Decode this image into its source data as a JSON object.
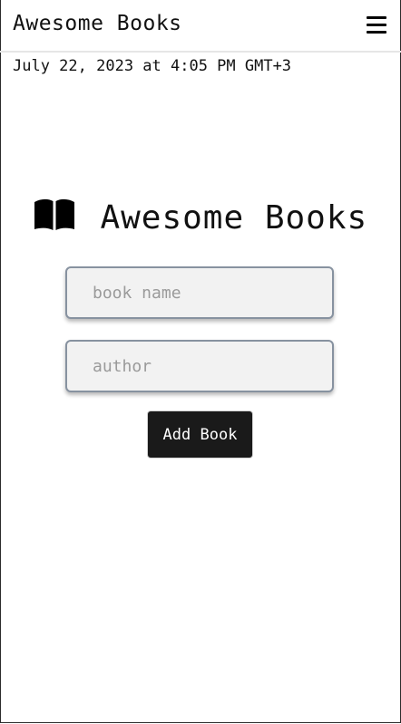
{
  "navbar": {
    "brand": "Awesome Books",
    "menu_icon": "hamburger-menu-icon"
  },
  "datetime": "July 22, 2023 at 4:05 PM GMT+3",
  "form": {
    "heading_icon": "open-book-icon",
    "heading": "Awesome Books",
    "title_input": {
      "value": "",
      "placeholder": "book name"
    },
    "author_input": {
      "value": "",
      "placeholder": "author"
    },
    "submit_label": "Add Book"
  },
  "colors": {
    "button_bg": "#1a1a1a",
    "button_text": "#ffffff",
    "input_bg": "#f2f2f2",
    "input_border": "#8792a0"
  }
}
